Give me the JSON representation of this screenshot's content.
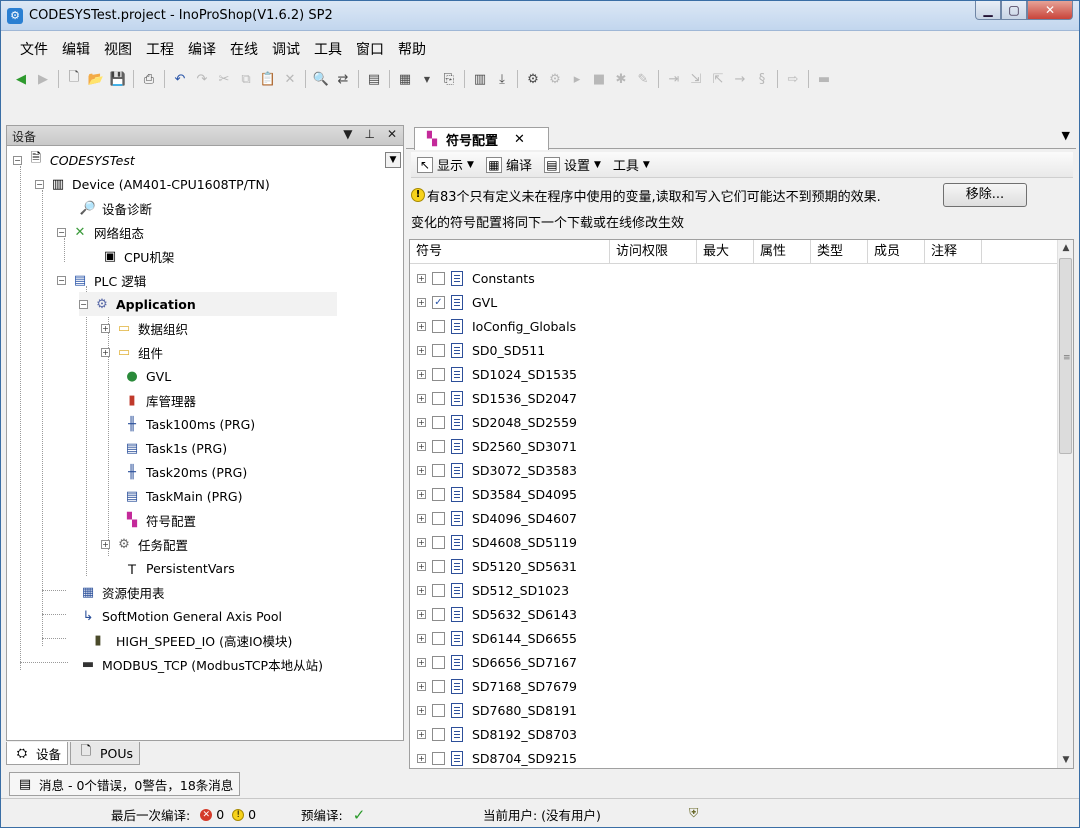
{
  "window": {
    "title": "CODESYSTest.project - InoProShop(V1.6.2) SP2"
  },
  "menu": [
    "文件",
    "编辑",
    "视图",
    "工程",
    "编译",
    "在线",
    "调试",
    "工具",
    "窗口",
    "帮助"
  ],
  "devices_panel": {
    "title": "设备",
    "tree": [
      {
        "label": "CODESYSTest",
        "icon": "project-icon",
        "italic": true
      },
      {
        "label": "Device (AM401-CPU1608TP/TN)",
        "icon": "device-icon"
      },
      {
        "label": "设备诊断",
        "icon": "diagnostics-icon"
      },
      {
        "label": "网络组态",
        "icon": "network-config-icon"
      },
      {
        "label": "CPU机架",
        "icon": "cpu-rack-icon"
      },
      {
        "label": "PLC 逻辑",
        "icon": "plc-logic-icon"
      },
      {
        "label": "Application",
        "icon": "application-gear-icon",
        "bold": true
      },
      {
        "label": "数据组织",
        "icon": "folder-icon"
      },
      {
        "label": "组件",
        "icon": "folder-icon"
      },
      {
        "label": "GVL",
        "icon": "globe-icon"
      },
      {
        "label": "库管理器",
        "icon": "library-books-icon"
      },
      {
        "label": "Task100ms (PRG)",
        "icon": "ladder-program-icon"
      },
      {
        "label": "Task1s (PRG)",
        "icon": "st-program-icon"
      },
      {
        "label": "Task20ms (PRG)",
        "icon": "ladder-program-icon"
      },
      {
        "label": "TaskMain (PRG)",
        "icon": "st-program-icon"
      },
      {
        "label": "符号配置",
        "icon": "symbol-config-icon"
      },
      {
        "label": "任务配置",
        "icon": "task-config-icon"
      },
      {
        "label": "PersistentVars",
        "icon": "persistent-vars-icon"
      },
      {
        "label": "资源使用表",
        "icon": "resource-table-icon"
      },
      {
        "label": "SoftMotion General Axis Pool",
        "icon": "axis-pool-icon"
      },
      {
        "label": "HIGH_SPEED_IO (高速IO模块)",
        "icon": "io-module-icon"
      },
      {
        "label": "MODBUS_TCP (ModbusTCP本地从站)",
        "icon": "modbus-icon"
      }
    ],
    "tabs": [
      "设备",
      "POUs"
    ]
  },
  "messages": {
    "label": "消息 - 0个错误，0警告，18条消息"
  },
  "statusbar": {
    "last_build_label": "最后一次编译:",
    "errors": "0",
    "warnings": "0",
    "precompile_label": "预编译:",
    "current_user": "当前用户: (没有用户)"
  },
  "editor": {
    "tab_label": "符号配置",
    "toolbar": {
      "display": "显示",
      "build": "编译",
      "settings": "设置",
      "tools": "工具"
    },
    "warning_text": "有83个只有定义未在程序中使用的变量,读取和写入它们可能达不到预期的效果.",
    "remove_button": "移除...",
    "info_text": "变化的符号配置将同下一个下载或在线修改生效",
    "columns": [
      "符号",
      "访问权限",
      "最大",
      "属性",
      "类型",
      "成员",
      "注释"
    ],
    "rows": [
      {
        "name": "Constants",
        "checked": false
      },
      {
        "name": "GVL",
        "checked": true
      },
      {
        "name": "IoConfig_Globals",
        "checked": false
      },
      {
        "name": "SD0_SD511",
        "checked": false
      },
      {
        "name": "SD1024_SD1535",
        "checked": false
      },
      {
        "name": "SD1536_SD2047",
        "checked": false
      },
      {
        "name": "SD2048_SD2559",
        "checked": false
      },
      {
        "name": "SD2560_SD3071",
        "checked": false
      },
      {
        "name": "SD3072_SD3583",
        "checked": false
      },
      {
        "name": "SD3584_SD4095",
        "checked": false
      },
      {
        "name": "SD4096_SD4607",
        "checked": false
      },
      {
        "name": "SD4608_SD5119",
        "checked": false
      },
      {
        "name": "SD5120_SD5631",
        "checked": false
      },
      {
        "name": "SD512_SD1023",
        "checked": false
      },
      {
        "name": "SD5632_SD6143",
        "checked": false
      },
      {
        "name": "SD6144_SD6655",
        "checked": false
      },
      {
        "name": "SD6656_SD7167",
        "checked": false
      },
      {
        "name": "SD7168_SD7679",
        "checked": false
      },
      {
        "name": "SD7680_SD8191",
        "checked": false
      },
      {
        "name": "SD8192_SD8703",
        "checked": false
      },
      {
        "name": "SD8704_SD9215",
        "checked": false
      }
    ]
  }
}
